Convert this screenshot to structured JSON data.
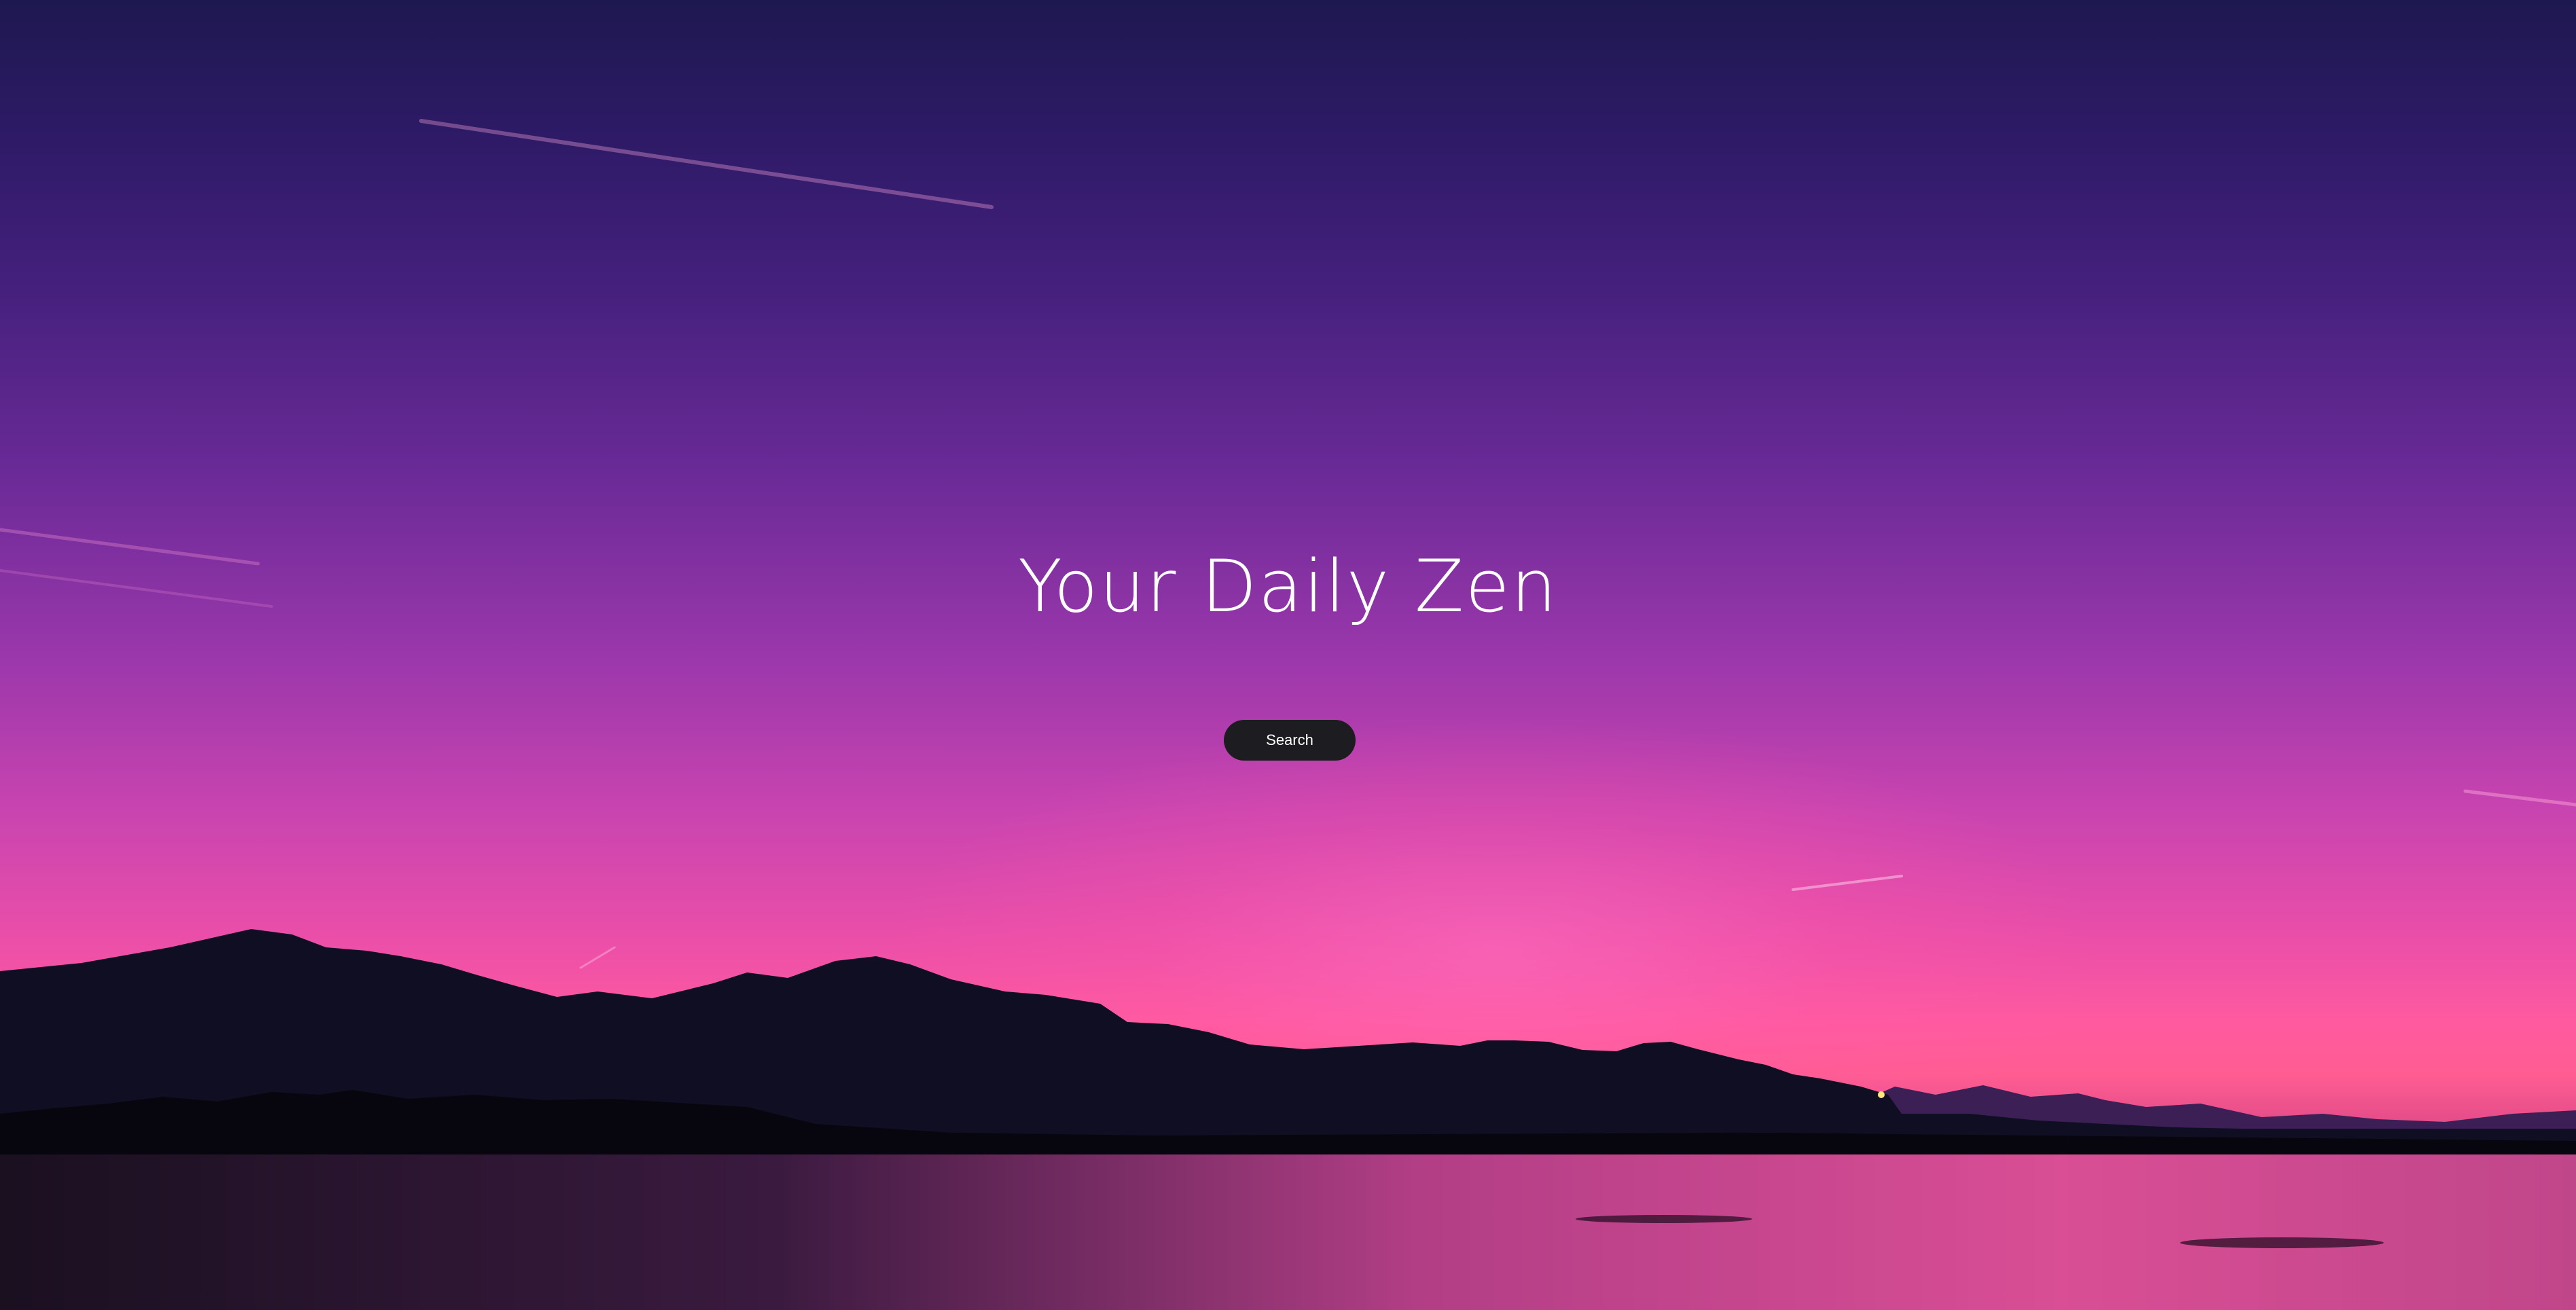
{
  "hero": {
    "title": "Your Daily Zen",
    "search_label": "Search"
  },
  "background": {
    "scene": "mountain-lake-sunset",
    "colors": {
      "sky_top": "#1e1850",
      "sky_mid": "#9a37ab",
      "horizon": "#ff5aa0",
      "mountains": "#0f0d1f",
      "button": "#1d1d21"
    }
  }
}
